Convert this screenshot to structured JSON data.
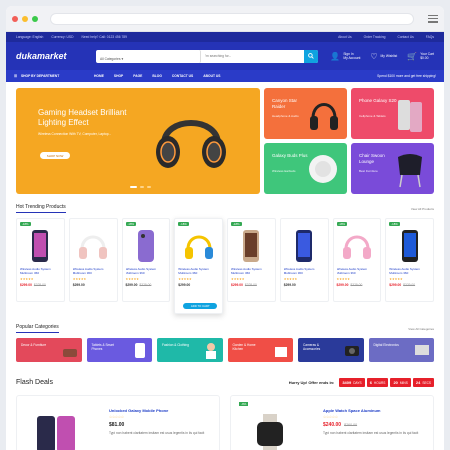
{
  "header": {
    "logo": "dukamarket",
    "search_category": "All Categories",
    "search_placeholder": "I'm searching for...",
    "account_label": "My Account",
    "account_sub": "Sign In",
    "wishlist_label": "My Wishlist",
    "cart_label": "Your Cart",
    "cart_total": "$0.00"
  },
  "topstrip": {
    "lang": "Language: English",
    "currency": "Currency: USD",
    "hotline": "Need help? Call: 0123 456 789",
    "links": [
      "About Us",
      "Order Tracking",
      "Contact Us",
      "FAQs"
    ]
  },
  "nav": {
    "shop_by": "SHOP BY DEPARTMENT",
    "links": [
      "HOME",
      "SHOP",
      "PAGE",
      "BLOG",
      "CONTACT US",
      "ABOUT US"
    ],
    "promo": "Spend $100 more and get free shipping!"
  },
  "hero": {
    "title": "Gaming Headset Brilliant Lighting Effect",
    "subtitle": "Wireless Connection With TV, Computer, Laptop...",
    "button": "SHOP NOW",
    "colors": {
      "main": "#f5a722",
      "t1": "#f4703c",
      "t2": "#ee4b6a",
      "t3": "#3fc67b",
      "t4": "#7a4bd9"
    },
    "tiles": [
      {
        "title": "Canyon Star Raider",
        "sub": "Headphone & Audio"
      },
      {
        "title": "Phone Galaxy S20",
        "sub": "Cellphone & Tablets"
      },
      {
        "title": "Galaxy Buds Plus",
        "sub": "Wireless Earbuds"
      },
      {
        "title": "Chair Swoon Lounge",
        "sub": "Best Furniture"
      }
    ]
  },
  "trending": {
    "title": "Hot Trending Products",
    "more": "View All Products",
    "products": [
      {
        "badge": "-18%",
        "name": "Wireless Audio System Multiroom 360",
        "stars": "★★★★★",
        "now": "$299.00",
        "old": "$329.00",
        "sale": true
      },
      {
        "badge": "",
        "name": "Wireless Audio System Multiroom 360",
        "stars": "★★★★★",
        "now": "$299.00",
        "old": "",
        "sale": false
      },
      {
        "badge": "-18%",
        "name": "Wireless Audio System Multiroom 360",
        "stars": "★★★★★",
        "now": "$299.00",
        "old": "$329.00",
        "sale": false
      },
      {
        "badge": "-18%",
        "name": "Wireless Audio System Multiroom 360",
        "stars": "★★★★★",
        "now": "$299.00",
        "old": "",
        "sale": false,
        "featured": true,
        "button": "ADD TO CART"
      },
      {
        "badge": "-18%",
        "name": "Wireless Audio System Multiroom 360",
        "stars": "★★★★★",
        "now": "$299.00",
        "old": "$329.00",
        "sale": true
      },
      {
        "badge": "",
        "name": "Wireless Audio System Multiroom 360",
        "stars": "★★★★★",
        "now": "$299.00",
        "old": "",
        "sale": false
      },
      {
        "badge": "-18%",
        "name": "Wireless Audio System Multiroom 360",
        "stars": "★★★★★",
        "now": "$299.00",
        "old": "$329.00",
        "sale": true
      },
      {
        "badge": "-18%",
        "name": "Wireless Audio System Multiroom 360",
        "stars": "★★★★★",
        "now": "$299.00",
        "old": "$329.00",
        "sale": true
      }
    ]
  },
  "categories": {
    "title": "Popular Categories",
    "more": "View All Categories",
    "items": [
      {
        "label": "Decor & Furniture",
        "color": "#e3495b"
      },
      {
        "label": "Tablets & Smart Phones",
        "color": "#6a5ae0"
      },
      {
        "label": "Fashion & Clothing",
        "color": "#1fb9a8"
      },
      {
        "label": "Garden & Home Kitchen",
        "color": "#f04e46"
      },
      {
        "label": "Cameras & Accessories",
        "color": "#2a3a9a"
      },
      {
        "label": "Digital Electronics",
        "color": "#6c6cc4"
      }
    ]
  },
  "flash": {
    "title": "Flash Deals",
    "hurry": "Hurry Up! Offer ends in:",
    "timer": [
      {
        "value": "3409",
        "unit": "DAYS"
      },
      {
        "value": "6",
        "unit": "HOURS"
      },
      {
        "value": "20",
        "unit": "MINS"
      },
      {
        "value": "24",
        "unit": "SECS"
      }
    ],
    "deals": [
      {
        "badge": "",
        "name": "Unlocked Galaxy Mobile Phone",
        "stars": "☆☆☆☆☆",
        "now": "$81.00",
        "old": "",
        "desc": "Typi non habent claritatem insitam est usus legentis in iis qui facit",
        "sale": false
      },
      {
        "badge": "-9%",
        "name": "Apple Watch Space Aluminum",
        "stars": "☆☆☆☆☆",
        "now": "$240.00",
        "old": "$260.00",
        "desc": "Typi non habent claritatem insitam est usus legentis in iis qui facit",
        "sale": true
      }
    ]
  }
}
